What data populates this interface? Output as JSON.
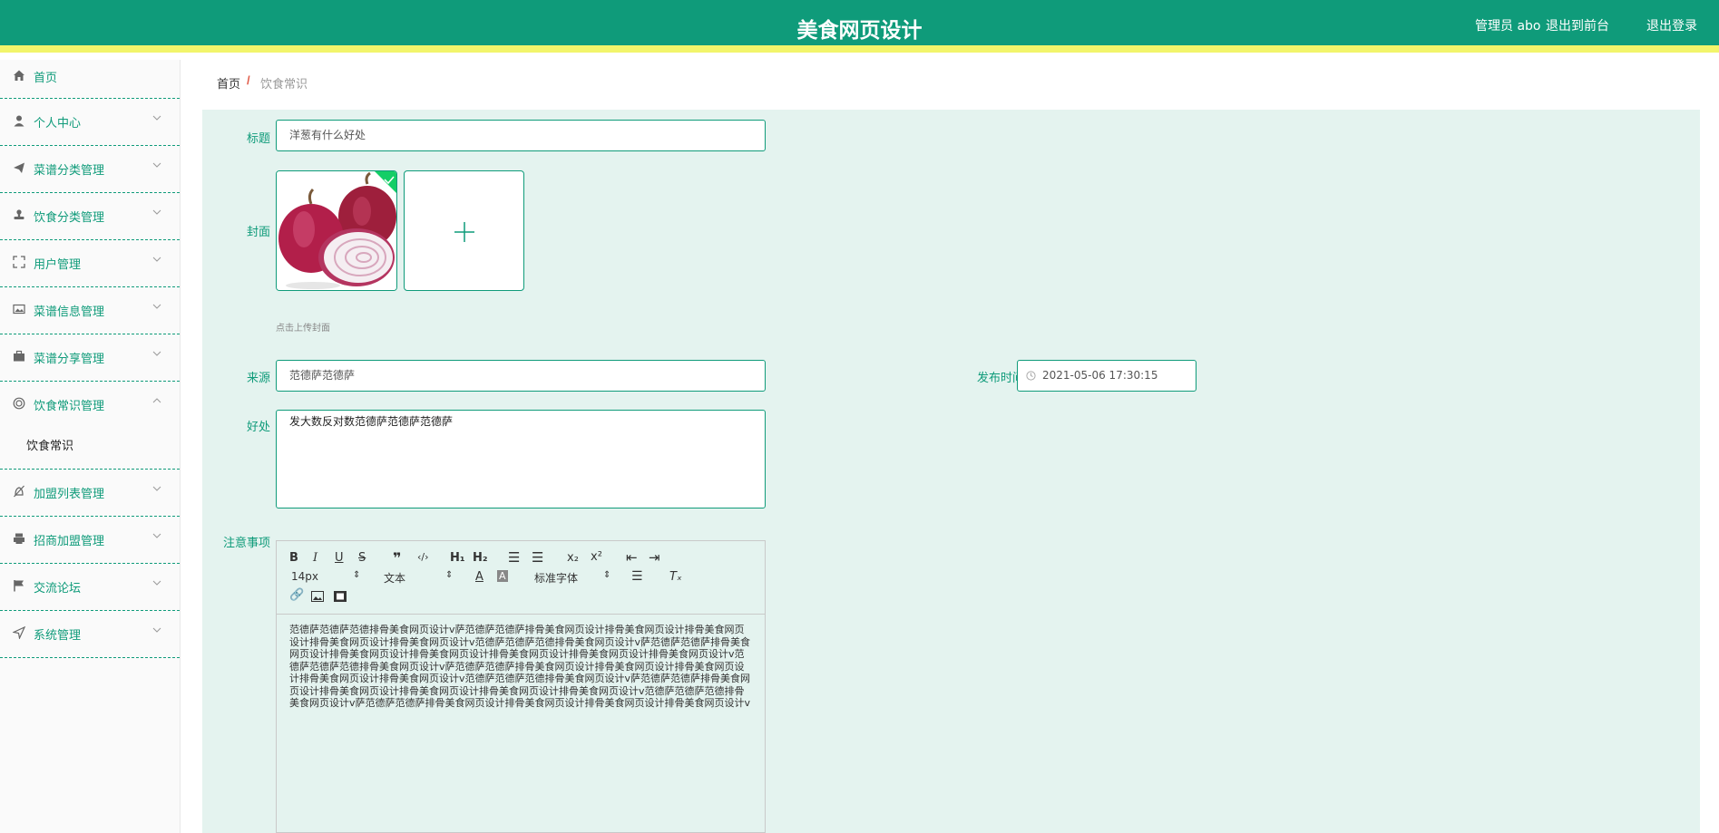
{
  "header": {
    "title": "美食网页设计",
    "admin": "管理员 abo",
    "back_front": "退出到前台",
    "logout": "退出登录"
  },
  "sidebar": {
    "items": [
      {
        "label": "首页",
        "icon": "home-icon"
      },
      {
        "label": "个人中心",
        "icon": "user-icon"
      },
      {
        "label": "菜谱分类管理",
        "icon": "send-icon"
      },
      {
        "label": "饮食分类管理",
        "icon": "stamp-icon"
      },
      {
        "label": "用户管理",
        "icon": "fullscreen-icon"
      },
      {
        "label": "菜谱信息管理",
        "icon": "picture-icon"
      },
      {
        "label": "菜谱分享管理",
        "icon": "suitcase-icon"
      },
      {
        "label": "饮食常识管理",
        "icon": "target-icon",
        "sub": "饮食常识"
      },
      {
        "label": "加盟列表管理",
        "icon": "bell-off-icon"
      },
      {
        "label": "招商加盟管理",
        "icon": "printer-icon"
      },
      {
        "label": "交流论坛",
        "icon": "flag-icon"
      },
      {
        "label": "系统管理",
        "icon": "position-icon"
      }
    ]
  },
  "breadcrumb": {
    "home": "首页",
    "sep": "/",
    "current": "饮食常识"
  },
  "form": {
    "title_label": "标题",
    "title_value": "洋葱有什么好处",
    "cover_label": "封面",
    "cover_hint": "点击上传封面",
    "source_label": "来源",
    "source_value": "范德萨范德萨",
    "time_label": "发布时间",
    "time_value": "2021-05-06 17:30:15",
    "benefit_label": "好处",
    "benefit_value": "发大数反对数范德萨范德萨范德萨",
    "notes_label": "注意事项"
  },
  "editor": {
    "size": "14px",
    "format": "文本",
    "font": "标准字体",
    "content": "范德萨范德萨范德排骨美食网页设计v萨范德萨范德萨排骨美食网页设计排骨美食网页设计排骨美食网页设计排骨美食网页设计排骨美食网页设计v范德萨范德萨范德排骨美食网页设计v萨范德萨范德萨排骨美食网页设计排骨美食网页设计排骨美食网页设计排骨美食网页设计排骨美食网页设计排骨美食网页设计v范德萨范德萨范德排骨美食网页设计v萨范德萨范德萨排骨美食网页设计排骨美食网页设计排骨美食网页设计排骨美食网页设计排骨美食网页设计v范德萨范德萨范德排骨美食网页设计v萨范德萨范德萨排骨美食网页设计排骨美食网页设计排骨美食网页设计排骨美食网页设计排骨美食网页设计v范德萨范德萨范德排骨美食网页设计v萨范德萨范德萨排骨美食网页设计排骨美食网页设计排骨美食网页设计排骨美食网页设计v"
  },
  "colors": {
    "primary": "#0f9b7a",
    "accent_stripe": "#f2f56b",
    "form_bg": "#e4f3ef"
  }
}
